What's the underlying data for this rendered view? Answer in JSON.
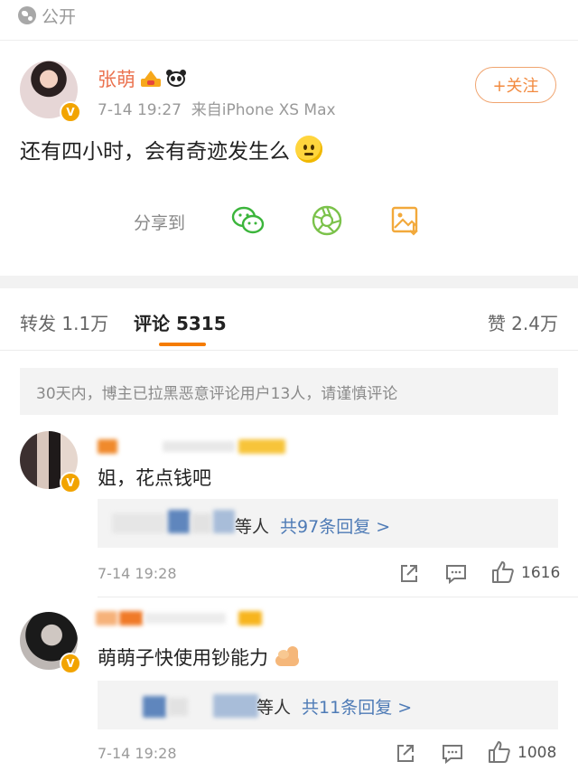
{
  "visibility": {
    "label": "公开"
  },
  "post": {
    "author": "张萌",
    "time": "7-14 19:27",
    "source": "来自iPhone XS Max",
    "follow_label": "+关注",
    "text": "还有四小时，会有奇迹发生么",
    "share_label": "分享到"
  },
  "tabs": {
    "forward": "转发 1.1万",
    "comments": "评论 5315",
    "likes": "赞 2.4万"
  },
  "notice": "30天内，博主已拉黑恶意评论用户13人，请谨慎评论",
  "comments": [
    {
      "text": "姐，花点钱吧",
      "reply_suffix": "等人",
      "reply_link": "共97条回复 >",
      "time": "7-14 19:28",
      "likes": "1616"
    },
    {
      "text": "萌萌子快使用钞能力",
      "reply_suffix": "等人",
      "reply_link": "共11条回复 >",
      "time": "7-14 19:28",
      "likes": "1008"
    }
  ],
  "colors": {
    "accent": "#f57c00",
    "name": "#eb7350",
    "link": "#4e7bb6",
    "badge": "#f2a400"
  }
}
